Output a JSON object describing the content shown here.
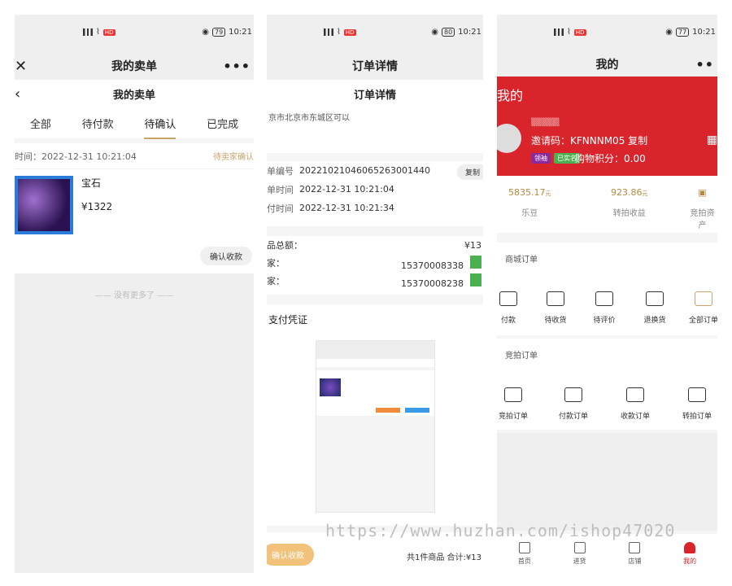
{
  "status": {
    "time": "10:21",
    "battery1": "79",
    "battery2": "80",
    "battery3": "77"
  },
  "panel1": {
    "title": "我的卖单",
    "sub_title": "我的卖单",
    "tabs": [
      "全部",
      "待付款",
      "待确认",
      "已完成"
    ],
    "order_time": "时间：2022-12-31 10:21:04",
    "order_status": "待卖家确认",
    "product_name": "宝石",
    "product_price": "¥1322",
    "confirm_label": "确认收款",
    "no_more": "—— 没有更多了 ——"
  },
  "panel2": {
    "title": "订单详情",
    "sub_title": "订单详情",
    "address": "京市北京市东城区可以",
    "rows": [
      {
        "k": "单编号",
        "v": "20221021046065263001440"
      },
      {
        "k": "单时间",
        "v": "2022-12-31 10:21:04"
      },
      {
        "k": "付时间",
        "v": "2022-12-31 10:21:34"
      }
    ],
    "copy_label": "复制",
    "money_total_label": "品总额：",
    "money_total_value": "¥13",
    "phone1_label": "家：",
    "phone1": "15370008338",
    "phone2_label": "家：",
    "phone2": "15370008238",
    "proof_title": "支付凭证",
    "confirm_label": "确认收款",
    "total": "共1件商品 合计:¥13"
  },
  "panel3": {
    "title": "我的",
    "banner_title": "我的",
    "invite": "邀请码：KFNNNM05  复制",
    "badge1": "领袖",
    "badge2": "已实名",
    "points": "购物积分：0.00",
    "asset1_value": "5835.17",
    "asset1_unit": "元",
    "asset1_label": "乐豆",
    "asset2_value": "923.86",
    "asset2_unit": "元",
    "asset2_label": "转拍收益",
    "asset3_label": "竞拍资产",
    "mall_orders": "商城订单",
    "mall_items": [
      "付款",
      "待收货",
      "待评价",
      "退换货",
      "全部订单"
    ],
    "auction_orders": "竞拍订单",
    "auction_items": [
      "竞拍订单",
      "付款订单",
      "收款订单",
      "转拍订单"
    ],
    "nav": [
      "首页",
      "进货",
      "店铺",
      "我的"
    ]
  },
  "watermark": "https://www.huzhan.com/ishop47020"
}
